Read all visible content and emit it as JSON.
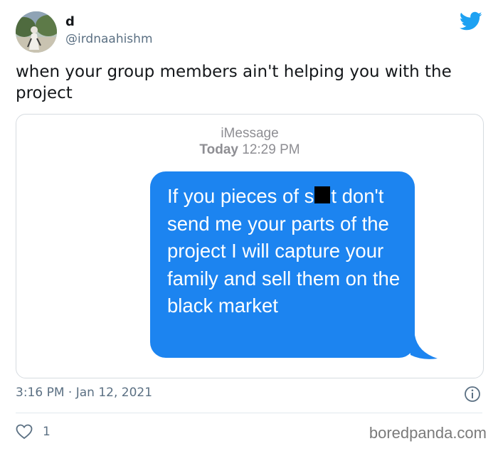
{
  "tweet": {
    "display_name": "d",
    "handle": "@irdnaahishm",
    "text": "when your group members ain't helping you with the project",
    "timestamp": "3:16 PM · Jan 12, 2021",
    "like_count": "1"
  },
  "screenshot": {
    "service_label": "iMessage",
    "day_label": "Today",
    "time_label": "12:29 PM",
    "message_part1": "If you pieces of s",
    "message_part2": "t don't send me your parts of the project I will capture your family and sell them on the black market"
  },
  "watermark": "boredpanda.com",
  "icons": {
    "brand": "twitter-bird-icon",
    "info": "info-icon",
    "like": "heart-icon"
  },
  "colors": {
    "twitter_blue": "#1da1f2",
    "bubble_blue": "#1c84f0",
    "secondary_text": "#5b7083"
  }
}
